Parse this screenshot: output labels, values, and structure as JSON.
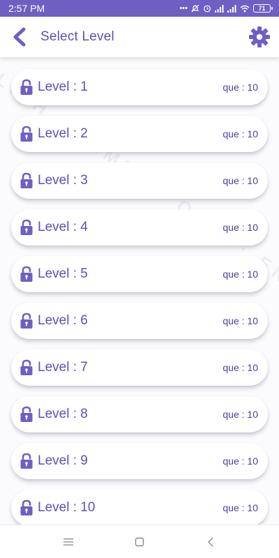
{
  "status_bar": {
    "time": "2:57 PM",
    "battery": "71"
  },
  "header": {
    "title": "Select Level"
  },
  "watermark": "ENGLISH GRAMMAR QUIZ · ENGLISH GRAMMAR QUIZ",
  "levels": [
    {
      "label": "Level : 1",
      "questions": "que : 10"
    },
    {
      "label": "Level : 2",
      "questions": "que : 10"
    },
    {
      "label": "Level : 3",
      "questions": "que : 10"
    },
    {
      "label": "Level : 4",
      "questions": "que : 10"
    },
    {
      "label": "Level : 5",
      "questions": "que : 10"
    },
    {
      "label": "Level : 6",
      "questions": "que : 10"
    },
    {
      "label": "Level : 7",
      "questions": "que : 10"
    },
    {
      "label": "Level : 8",
      "questions": "que : 10"
    },
    {
      "label": "Level : 9",
      "questions": "que : 10"
    },
    {
      "label": "Level : 10",
      "questions": "que : 10"
    }
  ],
  "icons": {
    "back": "arrow-back-icon",
    "settings": "gear-icon",
    "lock": "lock-icon",
    "nav_menu": "menu-icon",
    "nav_home": "home-square-icon",
    "nav_back": "back-chevron-icon"
  },
  "colors": {
    "primary": "#6f5fc3",
    "text_primary": "#5e4fb8"
  }
}
